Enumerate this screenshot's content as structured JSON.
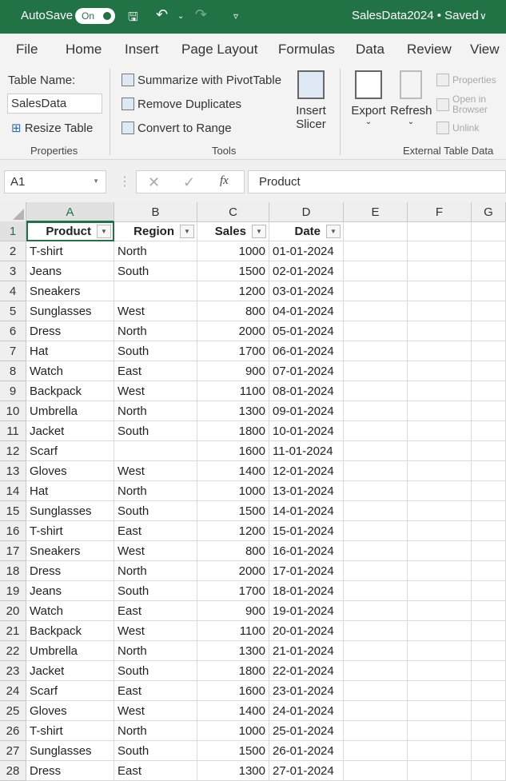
{
  "titlebar": {
    "autosave_label": "AutoSave",
    "autosave_state": "On",
    "doc_title": "SalesData2024 • Saved",
    "accent": "#217346"
  },
  "tabs": [
    "File",
    "Home",
    "Insert",
    "Page Layout",
    "Formulas",
    "Data",
    "Review",
    "View"
  ],
  "ribbon": {
    "properties": {
      "table_name_label": "Table Name:",
      "table_name_value": "SalesData",
      "resize": "Resize Table",
      "group": "Properties"
    },
    "tools": {
      "pivot": "Summarize with PivotTable",
      "dups": "Remove Duplicates",
      "convert": "Convert to Range",
      "slicer1": "Insert",
      "slicer2": "Slicer",
      "group": "Tools"
    },
    "external": {
      "export": "Export",
      "refresh": "Refresh",
      "properties": "Properties",
      "open": "Open in Browser",
      "unlink": "Unlink",
      "group": "External Table Data"
    }
  },
  "formula_bar": {
    "name_box": "A1",
    "content": "Product",
    "fx": "fx"
  },
  "columns": [
    "A",
    "B",
    "C",
    "D",
    "E",
    "F",
    "G"
  ],
  "headers": [
    "Product",
    "Region",
    "Sales",
    "Date"
  ],
  "rows": [
    [
      "T-shirt",
      "North",
      "1000",
      "01-01-2024"
    ],
    [
      "Jeans",
      "South",
      "1500",
      "02-01-2024"
    ],
    [
      "Sneakers",
      "",
      "1200",
      "03-01-2024"
    ],
    [
      "Sunglasses",
      "West",
      "800",
      "04-01-2024"
    ],
    [
      "Dress",
      "North",
      "2000",
      "05-01-2024"
    ],
    [
      "Hat",
      "South",
      "1700",
      "06-01-2024"
    ],
    [
      "Watch",
      "East",
      "900",
      "07-01-2024"
    ],
    [
      "Backpack",
      "West",
      "1100",
      "08-01-2024"
    ],
    [
      "Umbrella",
      "North",
      "1300",
      "09-01-2024"
    ],
    [
      "Jacket",
      "South",
      "1800",
      "10-01-2024"
    ],
    [
      "Scarf",
      "",
      "1600",
      "11-01-2024"
    ],
    [
      "Gloves",
      "West",
      "1400",
      "12-01-2024"
    ],
    [
      "Hat",
      "North",
      "1000",
      "13-01-2024"
    ],
    [
      "Sunglasses",
      "South",
      "1500",
      "14-01-2024"
    ],
    [
      "T-shirt",
      "East",
      "1200",
      "15-01-2024"
    ],
    [
      "Sneakers",
      "West",
      "800",
      "16-01-2024"
    ],
    [
      "Dress",
      "North",
      "2000",
      "17-01-2024"
    ],
    [
      "Jeans",
      "South",
      "1700",
      "18-01-2024"
    ],
    [
      "Watch",
      "East",
      "900",
      "19-01-2024"
    ],
    [
      "Backpack",
      "West",
      "1100",
      "20-01-2024"
    ],
    [
      "Umbrella",
      "North",
      "1300",
      "21-01-2024"
    ],
    [
      "Jacket",
      "South",
      "1800",
      "22-01-2024"
    ],
    [
      "Scarf",
      "East",
      "1600",
      "23-01-2024"
    ],
    [
      "Gloves",
      "West",
      "1400",
      "24-01-2024"
    ],
    [
      "T-shirt",
      "North",
      "1000",
      "25-01-2024"
    ],
    [
      "Sunglasses",
      "South",
      "1500",
      "26-01-2024"
    ],
    [
      "Dress",
      "East",
      "1300",
      "27-01-2024"
    ]
  ]
}
